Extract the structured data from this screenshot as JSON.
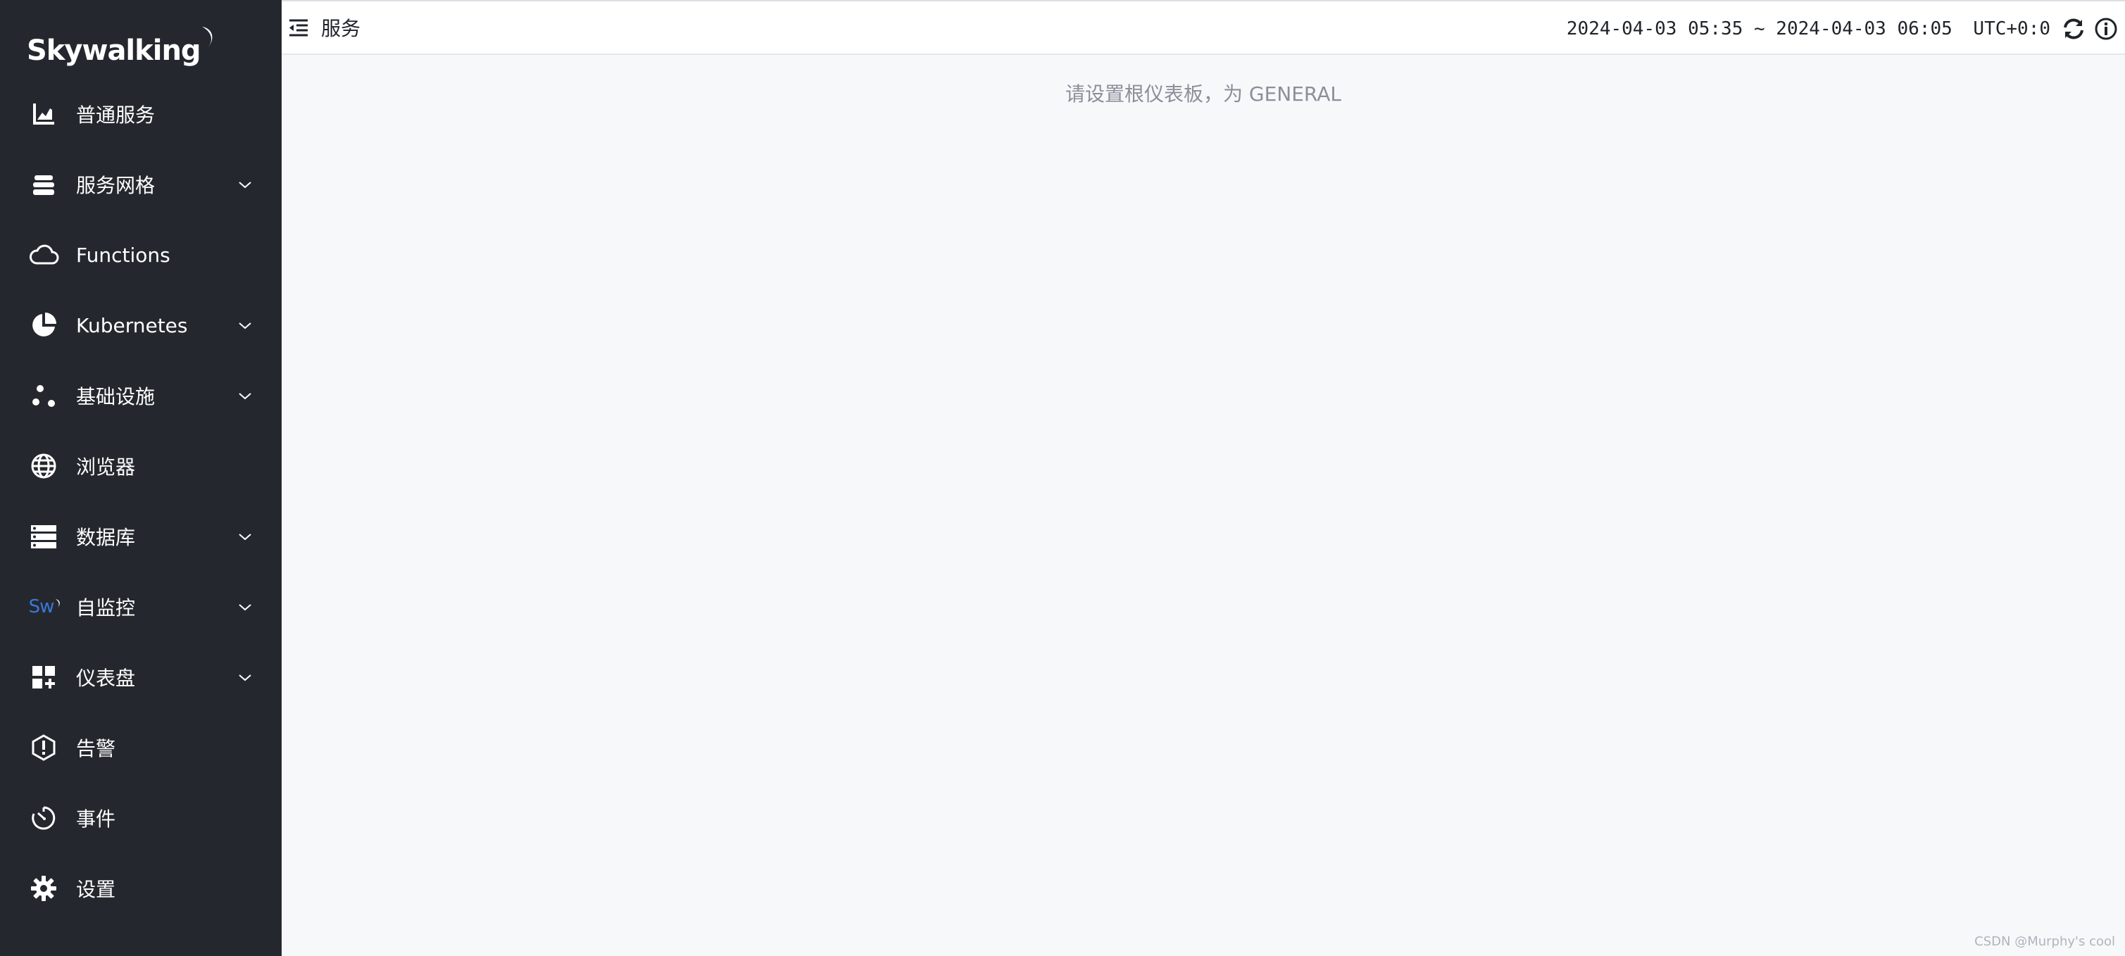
{
  "brand": {
    "logo_text": "Skywalking"
  },
  "sidebar": {
    "items": [
      {
        "label": "普通服务",
        "icon": "chart-icon",
        "has_submenu": false
      },
      {
        "label": "服务网格",
        "icon": "mesh-icon",
        "has_submenu": true
      },
      {
        "label": "Functions",
        "icon": "cloud-icon",
        "has_submenu": false
      },
      {
        "label": "Kubernetes",
        "icon": "pie-icon",
        "has_submenu": true
      },
      {
        "label": "基础设施",
        "icon": "nodes-icon",
        "has_submenu": true
      },
      {
        "label": "浏览器",
        "icon": "globe-icon",
        "has_submenu": false
      },
      {
        "label": "数据库",
        "icon": "database-icon",
        "has_submenu": true
      },
      {
        "label": "自监控",
        "icon": "sw-icon",
        "sw_text": "Sw",
        "has_submenu": true
      },
      {
        "label": "仪表盘",
        "icon": "dashboard-icon",
        "has_submenu": true
      },
      {
        "label": "告警",
        "icon": "alert-icon",
        "has_submenu": false
      },
      {
        "label": "事件",
        "icon": "event-icon",
        "has_submenu": false
      },
      {
        "label": "设置",
        "icon": "gear-icon",
        "has_submenu": false
      }
    ]
  },
  "header": {
    "title": "服务",
    "time_range": "2024-04-03 05:35 ~ 2024-04-03 06:05",
    "timezone": "UTC+0:0"
  },
  "main": {
    "empty_message": "请设置根仪表板，为 GENERAL"
  },
  "watermark": "CSDN @Murphy's cool",
  "colors": {
    "sidebar_bg": "#24282e",
    "content_bg": "#f7f8fa",
    "sw_blue": "#3a77d8"
  }
}
